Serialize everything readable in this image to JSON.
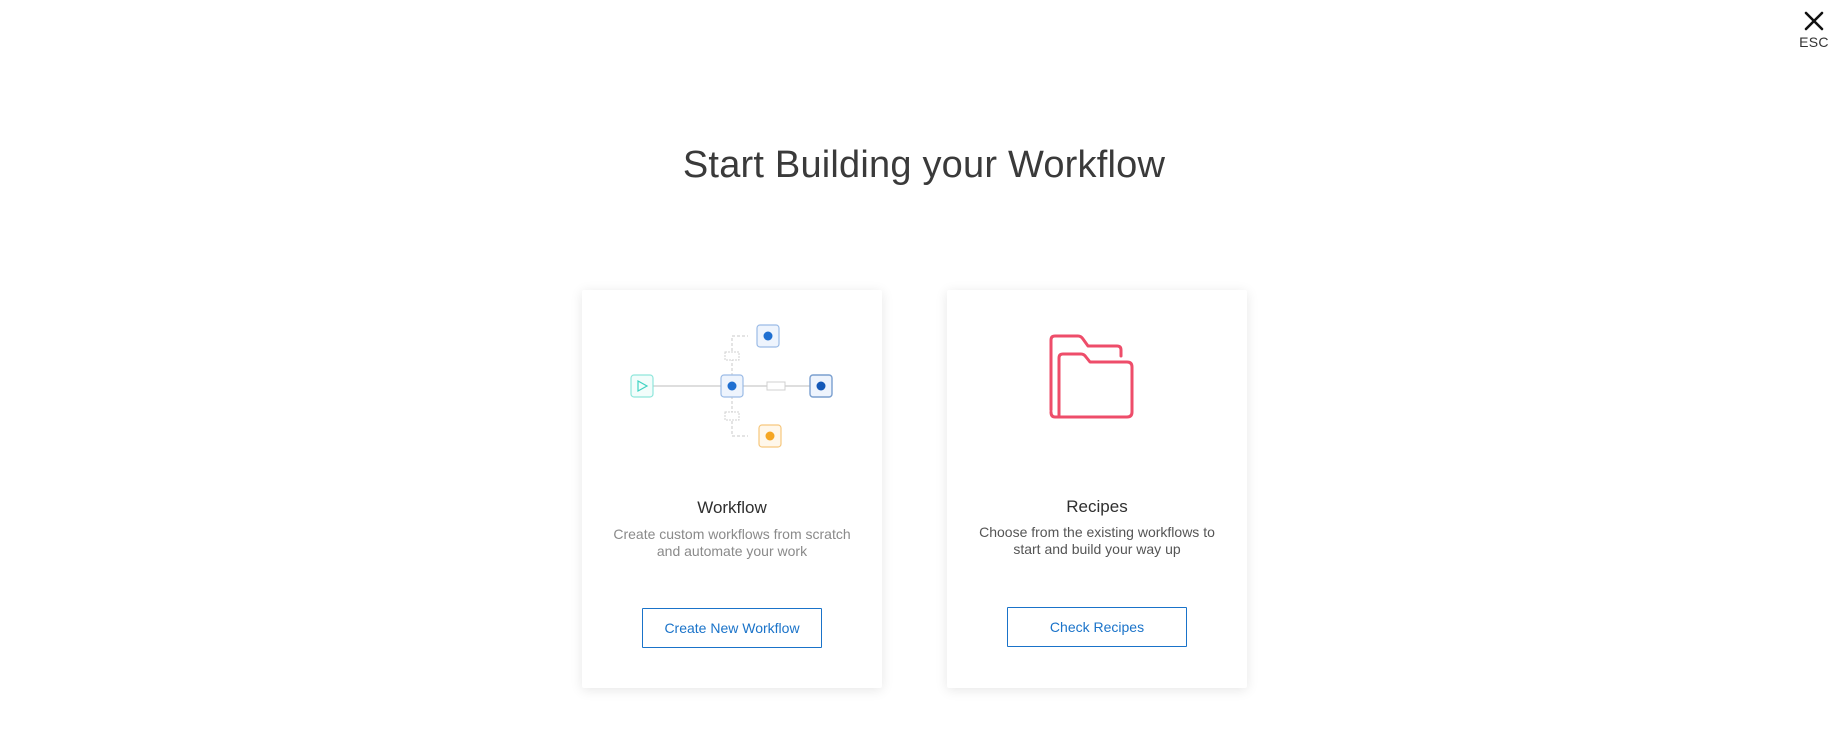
{
  "close": {
    "icon": "close-icon",
    "label": "ESC"
  },
  "title": "Start Building your Workflow",
  "cards": [
    {
      "icon": "workflow-diagram-icon",
      "title": "Workflow",
      "description": "Create custom workflows from scratch and automate your work",
      "button_label": "Create New Workflow"
    },
    {
      "icon": "folder-icon",
      "title": "Recipes",
      "description": "Choose from the existing workflows to start and build your way up",
      "button_label": "Check Recipes"
    }
  ],
  "colors": {
    "accent": "#1a73c9",
    "folder": "#ee4d6a",
    "trigger_node": "#3fd3c3",
    "action_node": "#1f6fd1",
    "branch_node": "#f5a623"
  }
}
